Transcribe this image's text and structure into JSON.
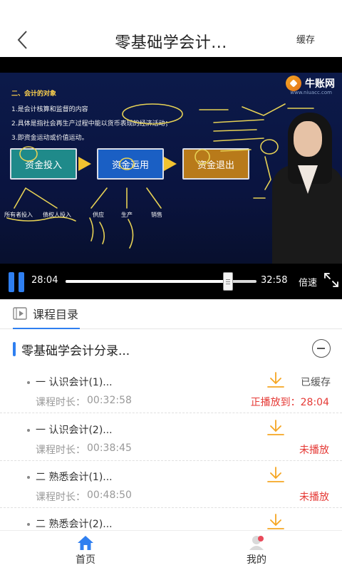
{
  "header": {
    "title": "零基础学会计...",
    "cache_label": "缓存"
  },
  "video": {
    "logo_text": "牛账网",
    "logo_url": "www.niuacc.com",
    "slide": {
      "heading": "二、会计的对象",
      "lines": [
        "1.是会计核算和监督的内容",
        "2.具体是指社会再生产过程中能以货币表现的经济活动；",
        "3.即资金运动或价值运动。"
      ],
      "boxes": [
        "资金投入",
        "资金运用",
        "资金退出"
      ],
      "sub_labels": [
        "所有者投入",
        "债权人投入",
        "供应",
        "生产",
        "销售"
      ]
    },
    "current_time": "28:04",
    "total_time": "32:58",
    "progress": 0.852,
    "speed_label": "倍速"
  },
  "tabs": {
    "catalog_label": "课程目录"
  },
  "section": {
    "title": "零基础学会计分录..."
  },
  "lessons": [
    {
      "name": "一 认识会计(1)...",
      "duration_label": "课程时长：",
      "duration": "00:32:58",
      "cached": "已缓存",
      "status": "正播放到：28:04"
    },
    {
      "name": "一 认识会计(2)...",
      "duration_label": "课程时长：",
      "duration": "00:38:45",
      "cached": "",
      "status": "未播放"
    },
    {
      "name": "二 熟悉会计(1)...",
      "duration_label": "课程时长：",
      "duration": "00:48:50",
      "cached": "",
      "status": "未播放"
    },
    {
      "name": "二 熟悉会计(2)...",
      "duration_label": "",
      "duration": "",
      "cached": "",
      "status": ""
    }
  ],
  "bottom_nav": {
    "home_label": "首页",
    "mine_label": "我的"
  },
  "colors": {
    "accent": "#2f7ff0",
    "download": "#f5a623",
    "status_red": "#e53935"
  }
}
